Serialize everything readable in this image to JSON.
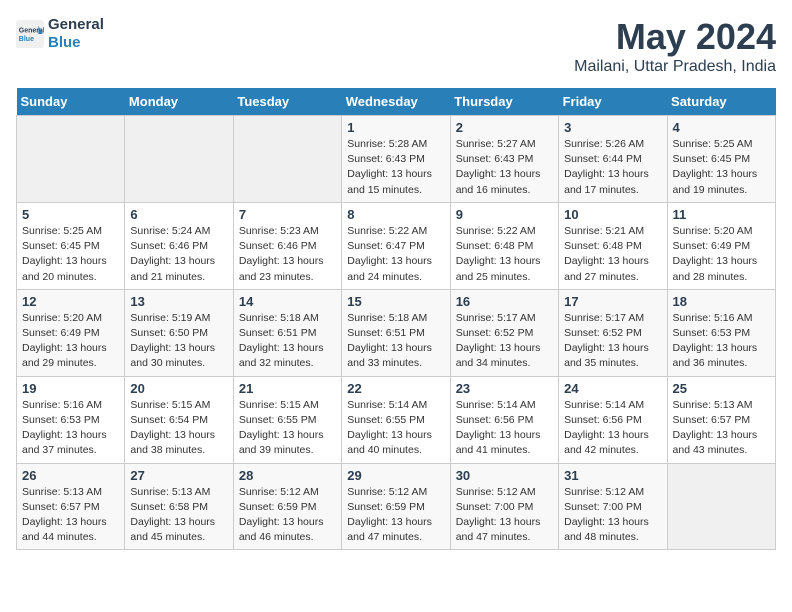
{
  "logo": {
    "line1": "General",
    "line2": "Blue"
  },
  "title": "May 2024",
  "location": "Mailani, Uttar Pradesh, India",
  "days_of_week": [
    "Sunday",
    "Monday",
    "Tuesday",
    "Wednesday",
    "Thursday",
    "Friday",
    "Saturday"
  ],
  "weeks": [
    [
      {
        "day": "",
        "info": ""
      },
      {
        "day": "",
        "info": ""
      },
      {
        "day": "",
        "info": ""
      },
      {
        "day": "1",
        "info": "Sunrise: 5:28 AM\nSunset: 6:43 PM\nDaylight: 13 hours\nand 15 minutes."
      },
      {
        "day": "2",
        "info": "Sunrise: 5:27 AM\nSunset: 6:43 PM\nDaylight: 13 hours\nand 16 minutes."
      },
      {
        "day": "3",
        "info": "Sunrise: 5:26 AM\nSunset: 6:44 PM\nDaylight: 13 hours\nand 17 minutes."
      },
      {
        "day": "4",
        "info": "Sunrise: 5:25 AM\nSunset: 6:45 PM\nDaylight: 13 hours\nand 19 minutes."
      }
    ],
    [
      {
        "day": "5",
        "info": "Sunrise: 5:25 AM\nSunset: 6:45 PM\nDaylight: 13 hours\nand 20 minutes."
      },
      {
        "day": "6",
        "info": "Sunrise: 5:24 AM\nSunset: 6:46 PM\nDaylight: 13 hours\nand 21 minutes."
      },
      {
        "day": "7",
        "info": "Sunrise: 5:23 AM\nSunset: 6:46 PM\nDaylight: 13 hours\nand 23 minutes."
      },
      {
        "day": "8",
        "info": "Sunrise: 5:22 AM\nSunset: 6:47 PM\nDaylight: 13 hours\nand 24 minutes."
      },
      {
        "day": "9",
        "info": "Sunrise: 5:22 AM\nSunset: 6:48 PM\nDaylight: 13 hours\nand 25 minutes."
      },
      {
        "day": "10",
        "info": "Sunrise: 5:21 AM\nSunset: 6:48 PM\nDaylight: 13 hours\nand 27 minutes."
      },
      {
        "day": "11",
        "info": "Sunrise: 5:20 AM\nSunset: 6:49 PM\nDaylight: 13 hours\nand 28 minutes."
      }
    ],
    [
      {
        "day": "12",
        "info": "Sunrise: 5:20 AM\nSunset: 6:49 PM\nDaylight: 13 hours\nand 29 minutes."
      },
      {
        "day": "13",
        "info": "Sunrise: 5:19 AM\nSunset: 6:50 PM\nDaylight: 13 hours\nand 30 minutes."
      },
      {
        "day": "14",
        "info": "Sunrise: 5:18 AM\nSunset: 6:51 PM\nDaylight: 13 hours\nand 32 minutes."
      },
      {
        "day": "15",
        "info": "Sunrise: 5:18 AM\nSunset: 6:51 PM\nDaylight: 13 hours\nand 33 minutes."
      },
      {
        "day": "16",
        "info": "Sunrise: 5:17 AM\nSunset: 6:52 PM\nDaylight: 13 hours\nand 34 minutes."
      },
      {
        "day": "17",
        "info": "Sunrise: 5:17 AM\nSunset: 6:52 PM\nDaylight: 13 hours\nand 35 minutes."
      },
      {
        "day": "18",
        "info": "Sunrise: 5:16 AM\nSunset: 6:53 PM\nDaylight: 13 hours\nand 36 minutes."
      }
    ],
    [
      {
        "day": "19",
        "info": "Sunrise: 5:16 AM\nSunset: 6:53 PM\nDaylight: 13 hours\nand 37 minutes."
      },
      {
        "day": "20",
        "info": "Sunrise: 5:15 AM\nSunset: 6:54 PM\nDaylight: 13 hours\nand 38 minutes."
      },
      {
        "day": "21",
        "info": "Sunrise: 5:15 AM\nSunset: 6:55 PM\nDaylight: 13 hours\nand 39 minutes."
      },
      {
        "day": "22",
        "info": "Sunrise: 5:14 AM\nSunset: 6:55 PM\nDaylight: 13 hours\nand 40 minutes."
      },
      {
        "day": "23",
        "info": "Sunrise: 5:14 AM\nSunset: 6:56 PM\nDaylight: 13 hours\nand 41 minutes."
      },
      {
        "day": "24",
        "info": "Sunrise: 5:14 AM\nSunset: 6:56 PM\nDaylight: 13 hours\nand 42 minutes."
      },
      {
        "day": "25",
        "info": "Sunrise: 5:13 AM\nSunset: 6:57 PM\nDaylight: 13 hours\nand 43 minutes."
      }
    ],
    [
      {
        "day": "26",
        "info": "Sunrise: 5:13 AM\nSunset: 6:57 PM\nDaylight: 13 hours\nand 44 minutes."
      },
      {
        "day": "27",
        "info": "Sunrise: 5:13 AM\nSunset: 6:58 PM\nDaylight: 13 hours\nand 45 minutes."
      },
      {
        "day": "28",
        "info": "Sunrise: 5:12 AM\nSunset: 6:59 PM\nDaylight: 13 hours\nand 46 minutes."
      },
      {
        "day": "29",
        "info": "Sunrise: 5:12 AM\nSunset: 6:59 PM\nDaylight: 13 hours\nand 47 minutes."
      },
      {
        "day": "30",
        "info": "Sunrise: 5:12 AM\nSunset: 7:00 PM\nDaylight: 13 hours\nand 47 minutes."
      },
      {
        "day": "31",
        "info": "Sunrise: 5:12 AM\nSunset: 7:00 PM\nDaylight: 13 hours\nand 48 minutes."
      },
      {
        "day": "",
        "info": ""
      }
    ]
  ]
}
